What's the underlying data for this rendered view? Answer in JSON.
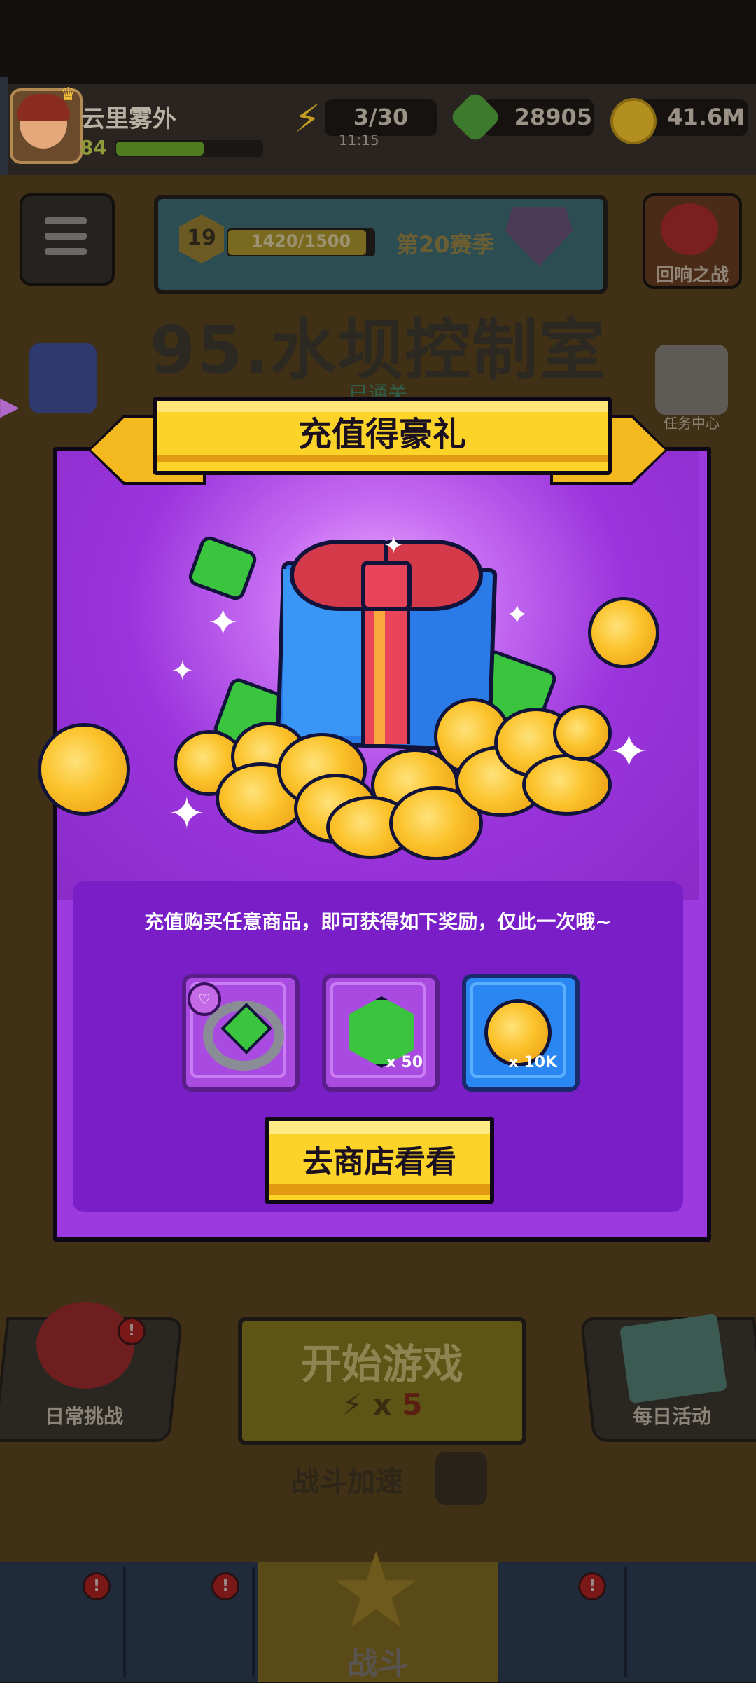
{
  "player": {
    "name": "云里雾外",
    "level": "84",
    "xp_fraction": 0.6
  },
  "resources": {
    "energy": "3/30",
    "energy_timer": "11:15",
    "gems": "28905",
    "coins": "41.6M"
  },
  "season": {
    "level": "19",
    "progress": "1420/1500",
    "progress_fraction": 0.947,
    "name": "第20赛季"
  },
  "echo_battle_label": "回响之战",
  "level_title": "95.水坝控制室",
  "cleared_label": "已通关",
  "task_center_label": "任务中心",
  "bottom": {
    "daily_challenge": "日常挑战",
    "start_game": "开始游戏",
    "start_cost_prefix": "x",
    "start_cost": "5",
    "daily_events": "每日活动",
    "battle_speed": "战斗加速",
    "nav_battle": "战斗",
    "badge": "!"
  },
  "modal": {
    "title": "充值得豪礼",
    "description": "充值购买任意商品，即可获得如下奖励，仅此一次哦~",
    "rewards": [
      {
        "icon": "ring-icon",
        "qty": ""
      },
      {
        "icon": "gem-icon",
        "qty": "x 50"
      },
      {
        "icon": "coin-icon",
        "qty": "x 10K"
      }
    ],
    "shop_button": "去商店看看"
  },
  "colors": {
    "modal_purple": "#9c3ae0",
    "banner_yellow": "#fcd429",
    "coin_gold": "#fbc22a",
    "gem_green": "#3bc43e"
  }
}
